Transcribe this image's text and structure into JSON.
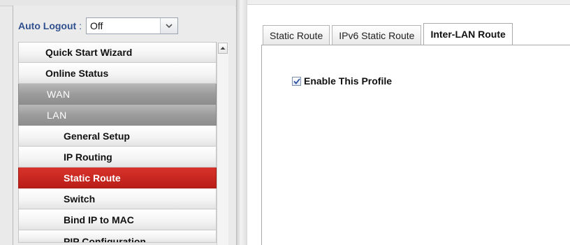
{
  "sidebar": {
    "auto_logout": {
      "label": "Auto Logout",
      "colon": " :",
      "value": "Off"
    },
    "menu": [
      {
        "label": "Quick Start Wizard",
        "type": "item",
        "level": 0
      },
      {
        "label": "Online Status",
        "type": "item",
        "level": 0
      },
      {
        "label": "WAN",
        "type": "group",
        "level": 0
      },
      {
        "label": "LAN",
        "type": "group",
        "level": 0
      },
      {
        "label": "General Setup",
        "type": "item",
        "level": 1
      },
      {
        "label": "IP Routing",
        "type": "item",
        "level": 1
      },
      {
        "label": "Static Route",
        "type": "item",
        "level": 1,
        "active": true
      },
      {
        "label": "Switch",
        "type": "item",
        "level": 1
      },
      {
        "label": "Bind IP to MAC",
        "type": "item",
        "level": 1
      },
      {
        "label": "PIP Configuration",
        "type": "item",
        "level": 1,
        "partial": true
      }
    ]
  },
  "tabs": [
    {
      "label": "Static Route",
      "active": false
    },
    {
      "label": "IPv6 Static Route",
      "active": false
    },
    {
      "label": "Inter-LAN Route",
      "active": true
    }
  ],
  "panel": {
    "enable_profile": {
      "label": "Enable This Profile",
      "checked": true
    }
  },
  "icons": {
    "dropdown": "chevron-down-icon",
    "scroll_up": "arrow-up-icon",
    "check": "check-icon"
  },
  "colors": {
    "active_menu": "#c8251e",
    "group_menu": "#9e9e9e",
    "label_blue": "#2f4f8f"
  }
}
